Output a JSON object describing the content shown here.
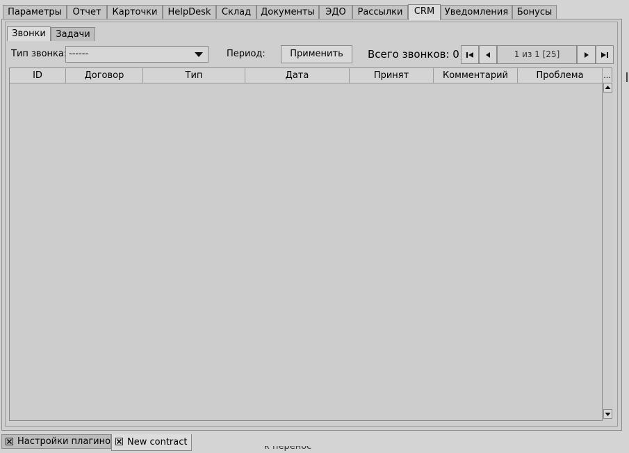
{
  "top_tabs": [
    {
      "label": "Параметры",
      "active": false
    },
    {
      "label": "Отчет",
      "active": false
    },
    {
      "label": "Карточки",
      "active": false
    },
    {
      "label": "HelpDesk",
      "active": false
    },
    {
      "label": "Склад",
      "active": false
    },
    {
      "label": "Документы",
      "active": false
    },
    {
      "label": "ЭДО",
      "active": false
    },
    {
      "label": "Рассылки",
      "active": false
    },
    {
      "label": "CRM",
      "active": true
    },
    {
      "label": "Уведомления",
      "active": false
    },
    {
      "label": "Бонусы",
      "active": false
    }
  ],
  "sub_tabs": [
    {
      "label": "Звонки",
      "active": true
    },
    {
      "label": "Задачи",
      "active": false
    }
  ],
  "toolbar": {
    "call_type_label": "Тип звонка:",
    "call_type_value": "------",
    "period_label": "Период:",
    "apply_label": "Применить",
    "total_calls": "Всего звонков: 0",
    "page_info": "1 из 1 [25]"
  },
  "table": {
    "columns": [
      "ID",
      "Договор",
      "Тип",
      "Дата",
      "Принят",
      "Комментарий",
      "Проблема"
    ],
    "more_label": "...",
    "rows": []
  },
  "doc_tabs": [
    {
      "label": "Настройки плагинов",
      "active": false
    },
    {
      "label": "New contract",
      "active": true
    }
  ],
  "background_text": "к перенос строк"
}
